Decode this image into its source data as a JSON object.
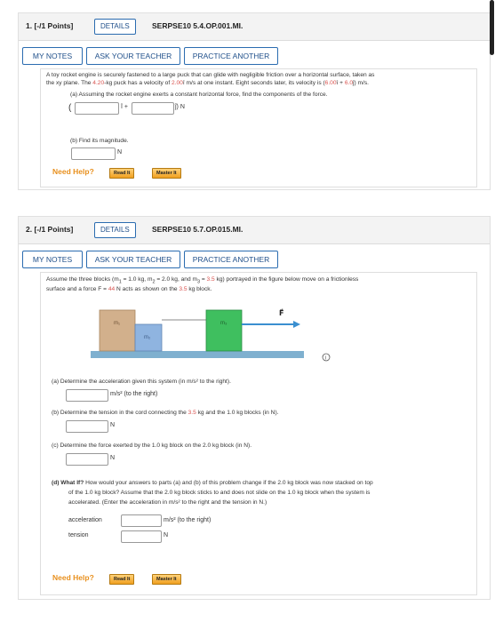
{
  "p1": {
    "title": "1. [-/1 Points]",
    "details": "DETAILS",
    "code": "SERPSE10 5.4.OP.001.MI.",
    "buttons": {
      "notes": "MY NOTES",
      "ask": "ASK YOUR TEACHER",
      "practice": "PRACTICE ANOTHER"
    },
    "line1": "A toy rocket engine is securely fastened to a large puck that can glide with negligible friction over a horizontal surface, taken as",
    "line2a": "the xy plane. The ",
    "mass": "4.20",
    "line2b": "-kg puck has a velocity of ",
    "vel1": "2.00",
    "line2c": "î m/s at one instant. Eight seconds later, its velocity is (",
    "vel2x": "6.00",
    "line2d": "î + ",
    "vel2y": "6.0",
    "line2e": "ĵ) m/s.",
    "a_text": "(a) Assuming the rocket engine exerts a constant horizontal force, find the components of the force.",
    "a_i": "î +",
    "a_j": "ĵ) N",
    "a_paren": "(",
    "b_text": "(b) Find its magnitude.",
    "b_unit": "N",
    "help": "Need Help?",
    "read": "Read It",
    "master": "Master It"
  },
  "p2": {
    "title": "2. [-/1 Points]",
    "details": "DETAILS",
    "code": "SERPSE10 5.7.OP.015.MI.",
    "buttons": {
      "notes": "MY NOTES",
      "ask": "ASK YOUR TEACHER",
      "practice": "PRACTICE ANOTHER"
    },
    "line1a": "Assume the three blocks (m",
    "line1b": " = 1.0 kg, m",
    "line1c": " = 2.0 kg, and m",
    "line1d": " = ",
    "m3": "3.5",
    "line1e": " kg) portrayed in the figure below move on a frictionless",
    "sub1": "1",
    "sub2": "2",
    "sub3": "3",
    "line2a": "surface and a force F = ",
    "force": "44",
    "line2b": " N acts as shown on the ",
    "m3b": "3.5",
    "line2c": " kg block.",
    "fig": {
      "m1": "m₁",
      "m2": "m₂",
      "m3": "m₃",
      "F": "F⃗",
      "info": "i"
    },
    "a_text": "(a)  Determine the acceleration given this system (in m/s² to the right).",
    "a_unit": "m/s² (to the right)",
    "b_text_a": "(b)  Determine the tension in the cord connecting the ",
    "b_m": "3.5",
    "b_text_b": " kg and the 1.0 kg blocks (in N).",
    "b_unit": "N",
    "c_text": "(c)  Determine the force exerted by the 1.0 kg block on the 2.0 kg block (in N).",
    "c_unit": "N",
    "d_label": "(d)  What If?",
    "d_line1": " How would your answers to parts (a) and (b) of this problem change if the 2.0 kg block was now stacked on top",
    "d_line2": "of the 1.0 kg block? Assume that the 2.0 kg block sticks to and does not slide on the 1.0 kg block when the system is",
    "d_line3": "accelerated. (Enter the acceleration in m/s² to the right and the tension in N.)",
    "accel_label": "acceleration",
    "accel_unit": "m/s² (to the right)",
    "tension_label": "tension",
    "tension_unit": "N",
    "help": "Need Help?",
    "read": "Read It",
    "master": "Master It"
  }
}
